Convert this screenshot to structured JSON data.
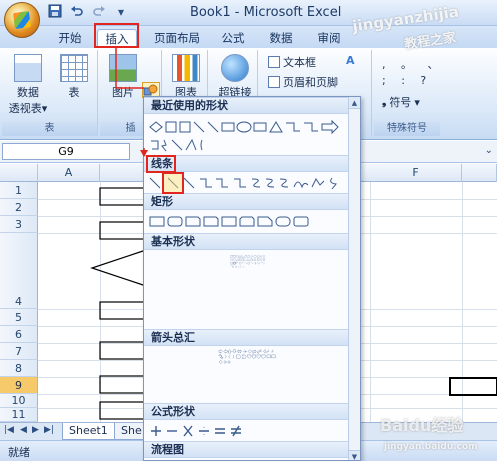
{
  "app": {
    "title": "Book1 - Microsoft Excel"
  },
  "quick_access": {
    "save_icon": "save-icon",
    "undo_icon": "undo-icon",
    "redo_icon": "redo-icon",
    "customize_icon": "chevron-down-icon"
  },
  "ribbon": {
    "tabs": [
      "开始",
      "插入",
      "页面布局",
      "公式",
      "数据",
      "审阅"
    ],
    "active_tab": "插入",
    "groups": {
      "tables": {
        "label": "表",
        "pivot_label": "数据\n透视表",
        "pivot_label_line1": "数据",
        "pivot_label_line2": "透视表",
        "pivot_dropdown": "▾",
        "table_label": "表"
      },
      "illustrations": {
        "label": "插",
        "picture_label": "图片"
      },
      "charts": {
        "chart_label": "图表"
      },
      "links": {
        "hyperlink_label": "超链接"
      },
      "text": {
        "textbox_label": "文本框",
        "header_footer_label": "页眉和页脚"
      },
      "symbols": {
        "label": "特殊符号",
        "symbol_label": "符号",
        "symbol_dropdown": "▾",
        "chars_row1": ", 。 、",
        "chars_row2": "; : ?"
      }
    }
  },
  "formula_bar": {
    "name_box": "G9"
  },
  "grid": {
    "columns": [
      "A",
      "F"
    ],
    "rows": [
      "1",
      "2",
      "3",
      "4",
      "5",
      "6",
      "7",
      "8",
      "9",
      "10",
      "11"
    ],
    "selected_row": "9"
  },
  "sheet_tabs": {
    "tabs": [
      "Sheet1",
      "She"
    ],
    "nav": [
      "|◀",
      "◀",
      "▶",
      "▶|"
    ]
  },
  "status_bar": {
    "status": "就绪"
  },
  "shapes_panel": {
    "sections": [
      "最近使用的形状",
      "线条",
      "矩形",
      "基本形状",
      "箭头总汇",
      "公式形状",
      "流程图"
    ]
  },
  "watermarks": {
    "top_right_1": "jingyanzhijia",
    "top_right_2": "教程之家",
    "bottom_right_1": "Baidu经验",
    "bottom_right_2": "jingyan.baidu.com"
  },
  "colors": {
    "accent_red": "#e0261f",
    "ribbon_blue": "#c4d9f4",
    "selection_yellow": "#f6c96a"
  }
}
